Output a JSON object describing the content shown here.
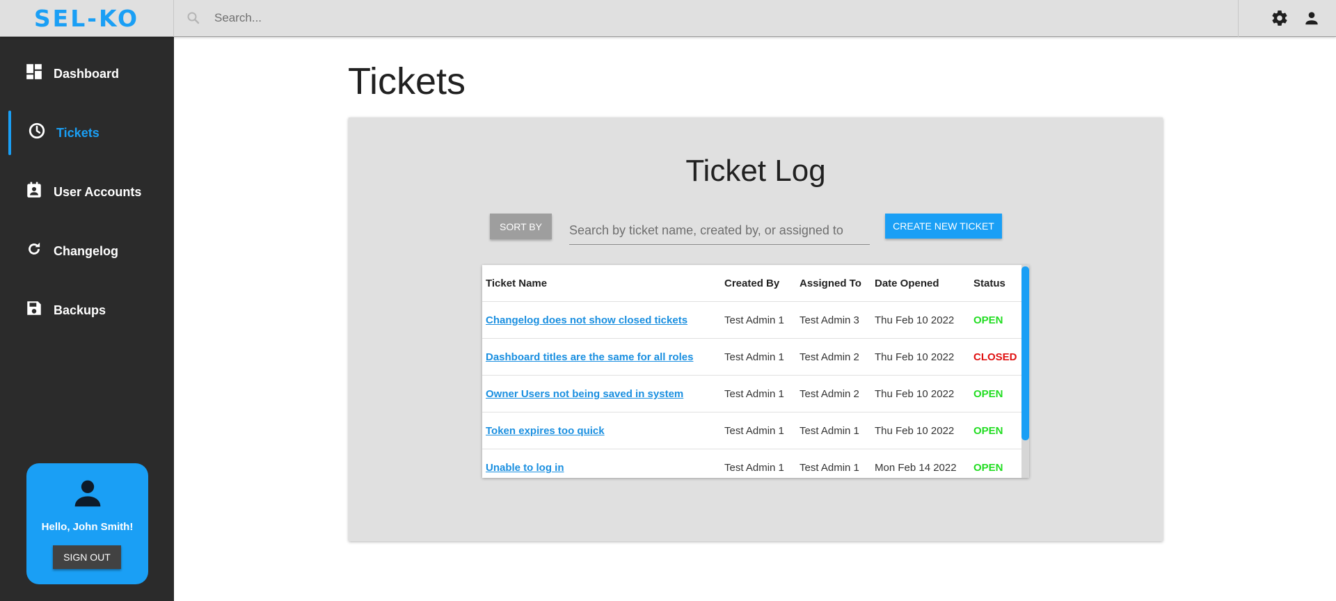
{
  "app": {
    "logo": "SEL-KO"
  },
  "topbar": {
    "search_placeholder": "Search...",
    "icons": {
      "search": "search-icon",
      "settings": "gear-icon",
      "account": "account-icon"
    }
  },
  "sidebar": {
    "items": [
      {
        "label": "Dashboard",
        "icon": "dashboard-icon",
        "active": false
      },
      {
        "label": "Tickets",
        "icon": "clock-icon",
        "active": true
      },
      {
        "label": "User Accounts",
        "icon": "user-badge-icon",
        "active": false
      },
      {
        "label": "Changelog",
        "icon": "refresh-icon",
        "active": false
      },
      {
        "label": "Backups",
        "icon": "floppy-icon",
        "active": false
      }
    ],
    "user_card": {
      "greeting": "Hello, John Smith!",
      "signout_label": "SIGN OUT"
    }
  },
  "main": {
    "page_title": "Tickets",
    "panel_title": "Ticket Log",
    "sort_label": "SORT BY",
    "search_placeholder": "Search by ticket name, created by, or assigned to",
    "create_label": "CREATE NEW TICKET",
    "table": {
      "headers": [
        "Ticket Name",
        "Created By",
        "Assigned To",
        "Date Opened",
        "Status"
      ],
      "rows": [
        {
          "name": "Changelog does not show closed tickets",
          "created_by": "Test Admin 1",
          "assigned_to": "Test Admin 3",
          "date": "Thu Feb 10 2022",
          "status": "OPEN"
        },
        {
          "name": "Dashboard titles are the same for all roles",
          "created_by": "Test Admin 1",
          "assigned_to": "Test Admin 2",
          "date": "Thu Feb 10 2022",
          "status": "CLOSED"
        },
        {
          "name": "Owner Users not being saved in system",
          "created_by": "Test Admin 1",
          "assigned_to": "Test Admin 2",
          "date": "Thu Feb 10 2022",
          "status": "OPEN"
        },
        {
          "name": "Token expires too quick",
          "created_by": "Test Admin 1",
          "assigned_to": "Test Admin 1",
          "date": "Thu Feb 10 2022",
          "status": "OPEN"
        },
        {
          "name": "Unable to log in",
          "created_by": "Test Admin 1",
          "assigned_to": "Test Admin 1",
          "date": "Mon Feb 14 2022",
          "status": "OPEN"
        }
      ]
    }
  },
  "colors": {
    "accent": "#1a9ff5",
    "sidebar_bg": "#2b2b2b",
    "status_open": "#22dd22",
    "status_closed": "#e01010"
  }
}
